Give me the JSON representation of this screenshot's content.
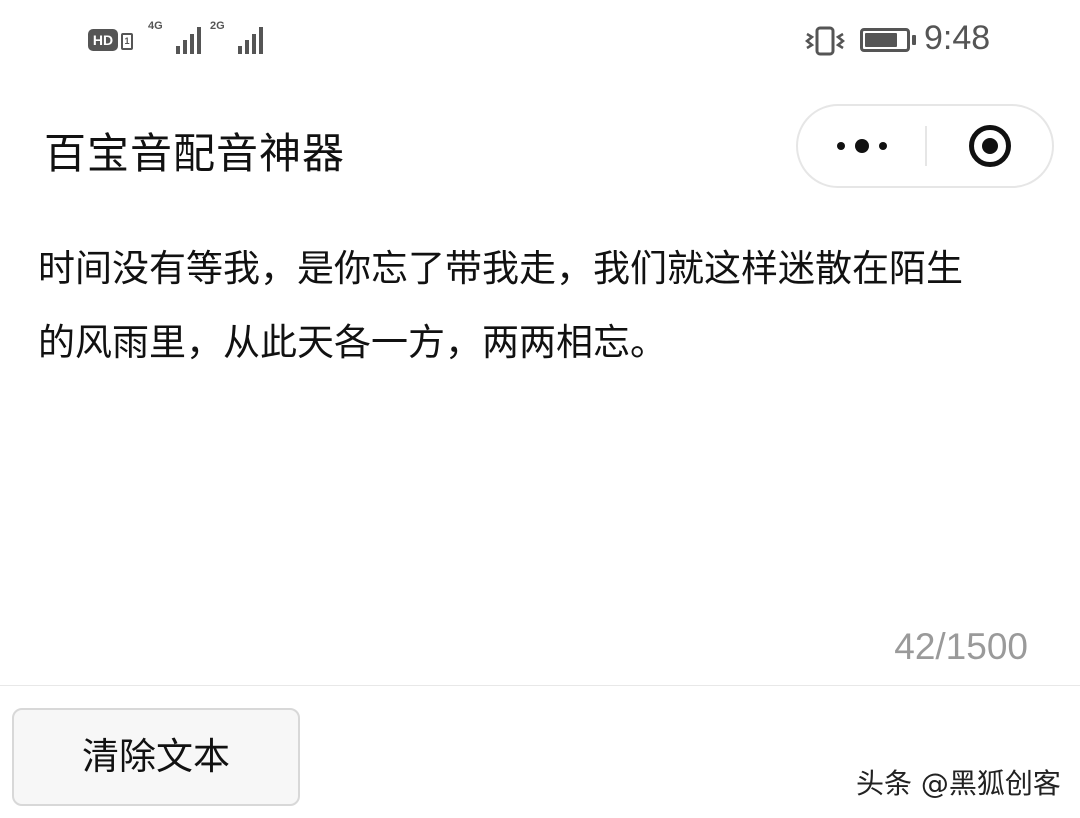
{
  "status_bar": {
    "hd_label": "HD",
    "hd_small_label": "1",
    "network_1": "4G",
    "network_2": "2G",
    "vibrate_icon": "vibrate-icon",
    "battery_icon": "battery-icon",
    "battery_level": 0.85,
    "time": "9:48",
    "icon_color": "#555555"
  },
  "header": {
    "title": "百宝音配音神器",
    "more_icon": "more-dots-icon",
    "close_icon": "target-circle-icon"
  },
  "editor": {
    "lines": [
      "时间没有等我，是你忘了带我走，我们就这样迷散在陌生",
      "的风雨里，从此天各一方，两两相忘。"
    ],
    "char_count": "42/1500"
  },
  "footer": {
    "clear_button_label": "清除文本"
  },
  "watermark": "头条 @黑狐创客"
}
